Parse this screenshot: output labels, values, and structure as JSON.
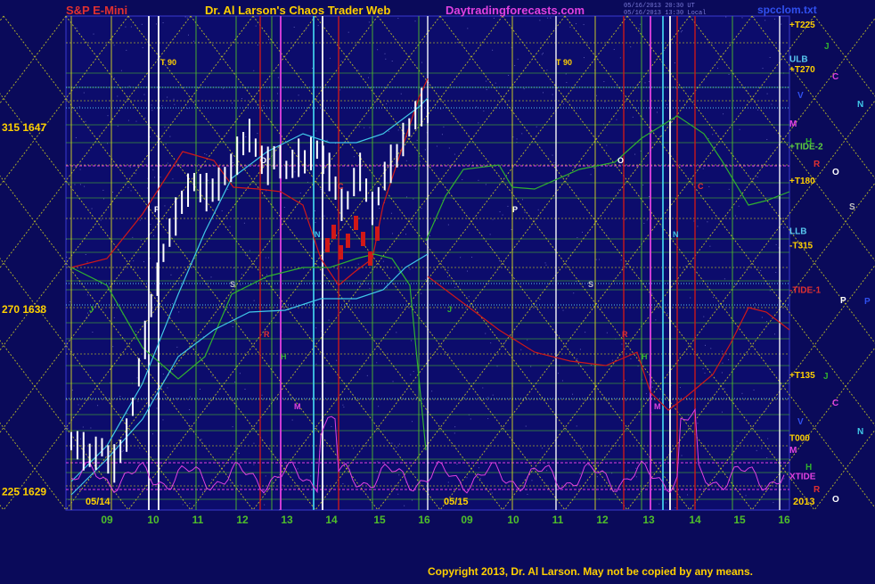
{
  "header": {
    "instrument": "S&P E-Mini",
    "site_title": "Dr. Al Larson's Chaos Trader Web",
    "site_url": "Daytradingforecasts.com",
    "stamp_line1": "05/16/2013 20:30 UT",
    "stamp_line2": "05/16/2013 13:30 Local",
    "file_name": "spcclom.txt"
  },
  "footer": {
    "copyright": "Copyright 2013, Dr. Al Larson. May not be copied by any means."
  },
  "colors": {
    "background": "#0a0a5a",
    "plot_bg": "#0c0c6c",
    "price_bars": "#ffffff",
    "flux_yellow": "#d8d820",
    "grid_green": "#4fbf2a",
    "red_line": "#d01818",
    "cyan_line": "#40c8e8",
    "green_line": "#30b030",
    "magenta": "#e040e0",
    "yellow_label": "#ffd000"
  },
  "chart_data": {
    "type": "line",
    "title": "S&P E-Mini",
    "y_axis_labels": [
      {
        "label": "315  1647",
        "value": 1647
      },
      {
        "label": "270  1638",
        "value": 1638
      },
      {
        "label": "225  1629",
        "value": 1629
      }
    ],
    "ylim": [
      1628.1,
      1652.5
    ],
    "x_tick_labels": [
      "09",
      "10",
      "11",
      "12",
      "13",
      "14",
      "15",
      "16",
      "09",
      "10",
      "11",
      "12",
      "13",
      "14",
      "15",
      "16"
    ],
    "date_labels": [
      "05/14",
      "05/15"
    ],
    "year_label": "2013",
    "right_level_labels": [
      {
        "label": "+T225",
        "value": 1652.1
      },
      {
        "label": "ULB",
        "value": 1650.4
      },
      {
        "label": "+T270",
        "value": 1649.9
      },
      {
        "label": "+TIDE-2",
        "value": 1646.1
      },
      {
        "label": "+T180",
        "value": 1644.4
      },
      {
        "label": "LLB",
        "value": 1641.9
      },
      {
        "label": "-T315",
        "value": 1641.2
      },
      {
        "label": "-TIDE-1",
        "value": 1639.0
      },
      {
        "label": "+T135",
        "value": 1634.8
      },
      {
        "label": "T000",
        "value": 1631.7
      },
      {
        "label": "XTIDE",
        "value": 1629.8
      }
    ],
    "planet_markers": [
      "J",
      "C",
      "V",
      "N",
      "M",
      "H",
      "R",
      "O",
      "S",
      "P"
    ],
    "chart_markers": [
      "T  90",
      "O",
      "P",
      "C",
      "N",
      "S",
      "J",
      "R",
      "H",
      "M"
    ],
    "series": [
      {
        "name": "price",
        "type": "bars",
        "values": [
          1631.5,
          1631.3,
          1631.0,
          1630.8,
          1630.9,
          1631.2,
          1630.6,
          1630.4,
          1631.0,
          1631.8,
          1633.2,
          1634.9,
          1636.5,
          1638.2,
          1639.5,
          1640.8,
          1641.8,
          1642.6,
          1643.3,
          1643.9,
          1644.3,
          1644.0,
          1643.8,
          1643.9,
          1644.2,
          1644.6,
          1645.0,
          1645.6,
          1646.2,
          1646.6,
          1646.0,
          1645.4,
          1645.1,
          1645.5,
          1645.3,
          1644.9,
          1645.2,
          1645.5,
          1645.3,
          1645.7,
          1645.9,
          1645.4,
          1644.8,
          1644.0,
          1643.2,
          1643.4,
          1644.3,
          1644.8,
          1643.9,
          1643.0,
          1643.6,
          1644.6,
          1645.2,
          1645.6,
          1646.4,
          1647.0,
          1647.6,
          1648.0,
          1647.8
        ]
      }
    ]
  }
}
